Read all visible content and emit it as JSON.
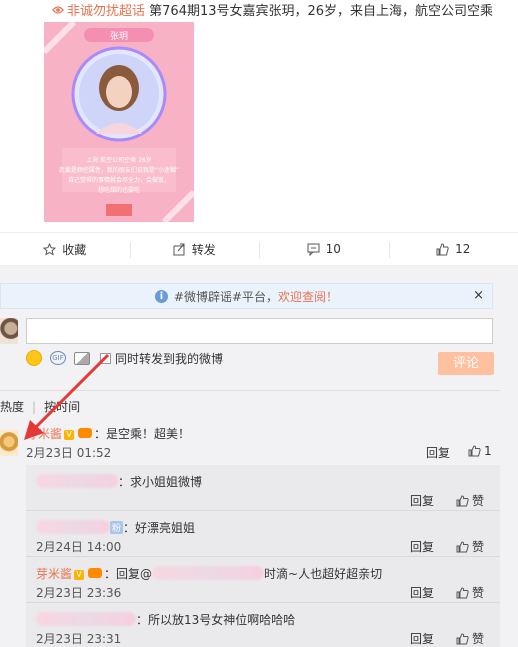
{
  "post": {
    "tag": "非诚勿扰超话",
    "title": "第764期13号女嘉宾张玥，26岁，来自上海，航空公司空乘",
    "poster": {
      "name": "张玥",
      "caption1": "上海 航空公司空乘 26岁",
      "caption2": "恋爱是颜控属性，我的朋友们说我是“小迷糊”",
      "caption3": "自己觉得的事情就会尽全力，会做饭，",
      "caption4": "想吃甜的也要吃"
    }
  },
  "actions": [
    {
      "icon": "star-icon",
      "label": "收藏"
    },
    {
      "icon": "forward-icon",
      "label": "转发"
    },
    {
      "icon": "comment-icon",
      "label": "10"
    },
    {
      "icon": "thumbs-up-icon",
      "label": "12"
    }
  ],
  "notice": {
    "prefix": "#微博辟谣#平台，",
    "link": "欢迎查阅！",
    "close": "×"
  },
  "composer": {
    "placeholder": "",
    "forward_label": "同时转发到我的微博",
    "submit_label": "评论"
  },
  "sort": {
    "hot": "热度",
    "time": "按时间"
  },
  "comment": {
    "author": "芽米酱",
    "text": "：是空乘！超美！",
    "time": "2月23日 01:52",
    "reply_label": "回复",
    "like_count": "1"
  },
  "replies": [
    {
      "text": "：求小姐姐微博",
      "time": "",
      "reply": "回复",
      "like": "赞"
    },
    {
      "badge": "粉",
      "text": "：好漂亮姐姐",
      "time": "2月24日 14:00",
      "reply": "回复",
      "like": "赞"
    },
    {
      "author": "芽米酱",
      "text_prefix": "：回复@",
      "text": "时滴~人也超好超亲切",
      "time": "2月23日 23:36",
      "reply": "回复",
      "like": "赞"
    },
    {
      "text": "：所以放13号女神位啊哈哈哈",
      "time": "2月23日 23:31",
      "reply": "回复",
      "like": "赞"
    }
  ],
  "colors": {
    "accent": "#eb7350",
    "submit": "#ffc09f",
    "poster_bg": "#f8b6c7"
  }
}
